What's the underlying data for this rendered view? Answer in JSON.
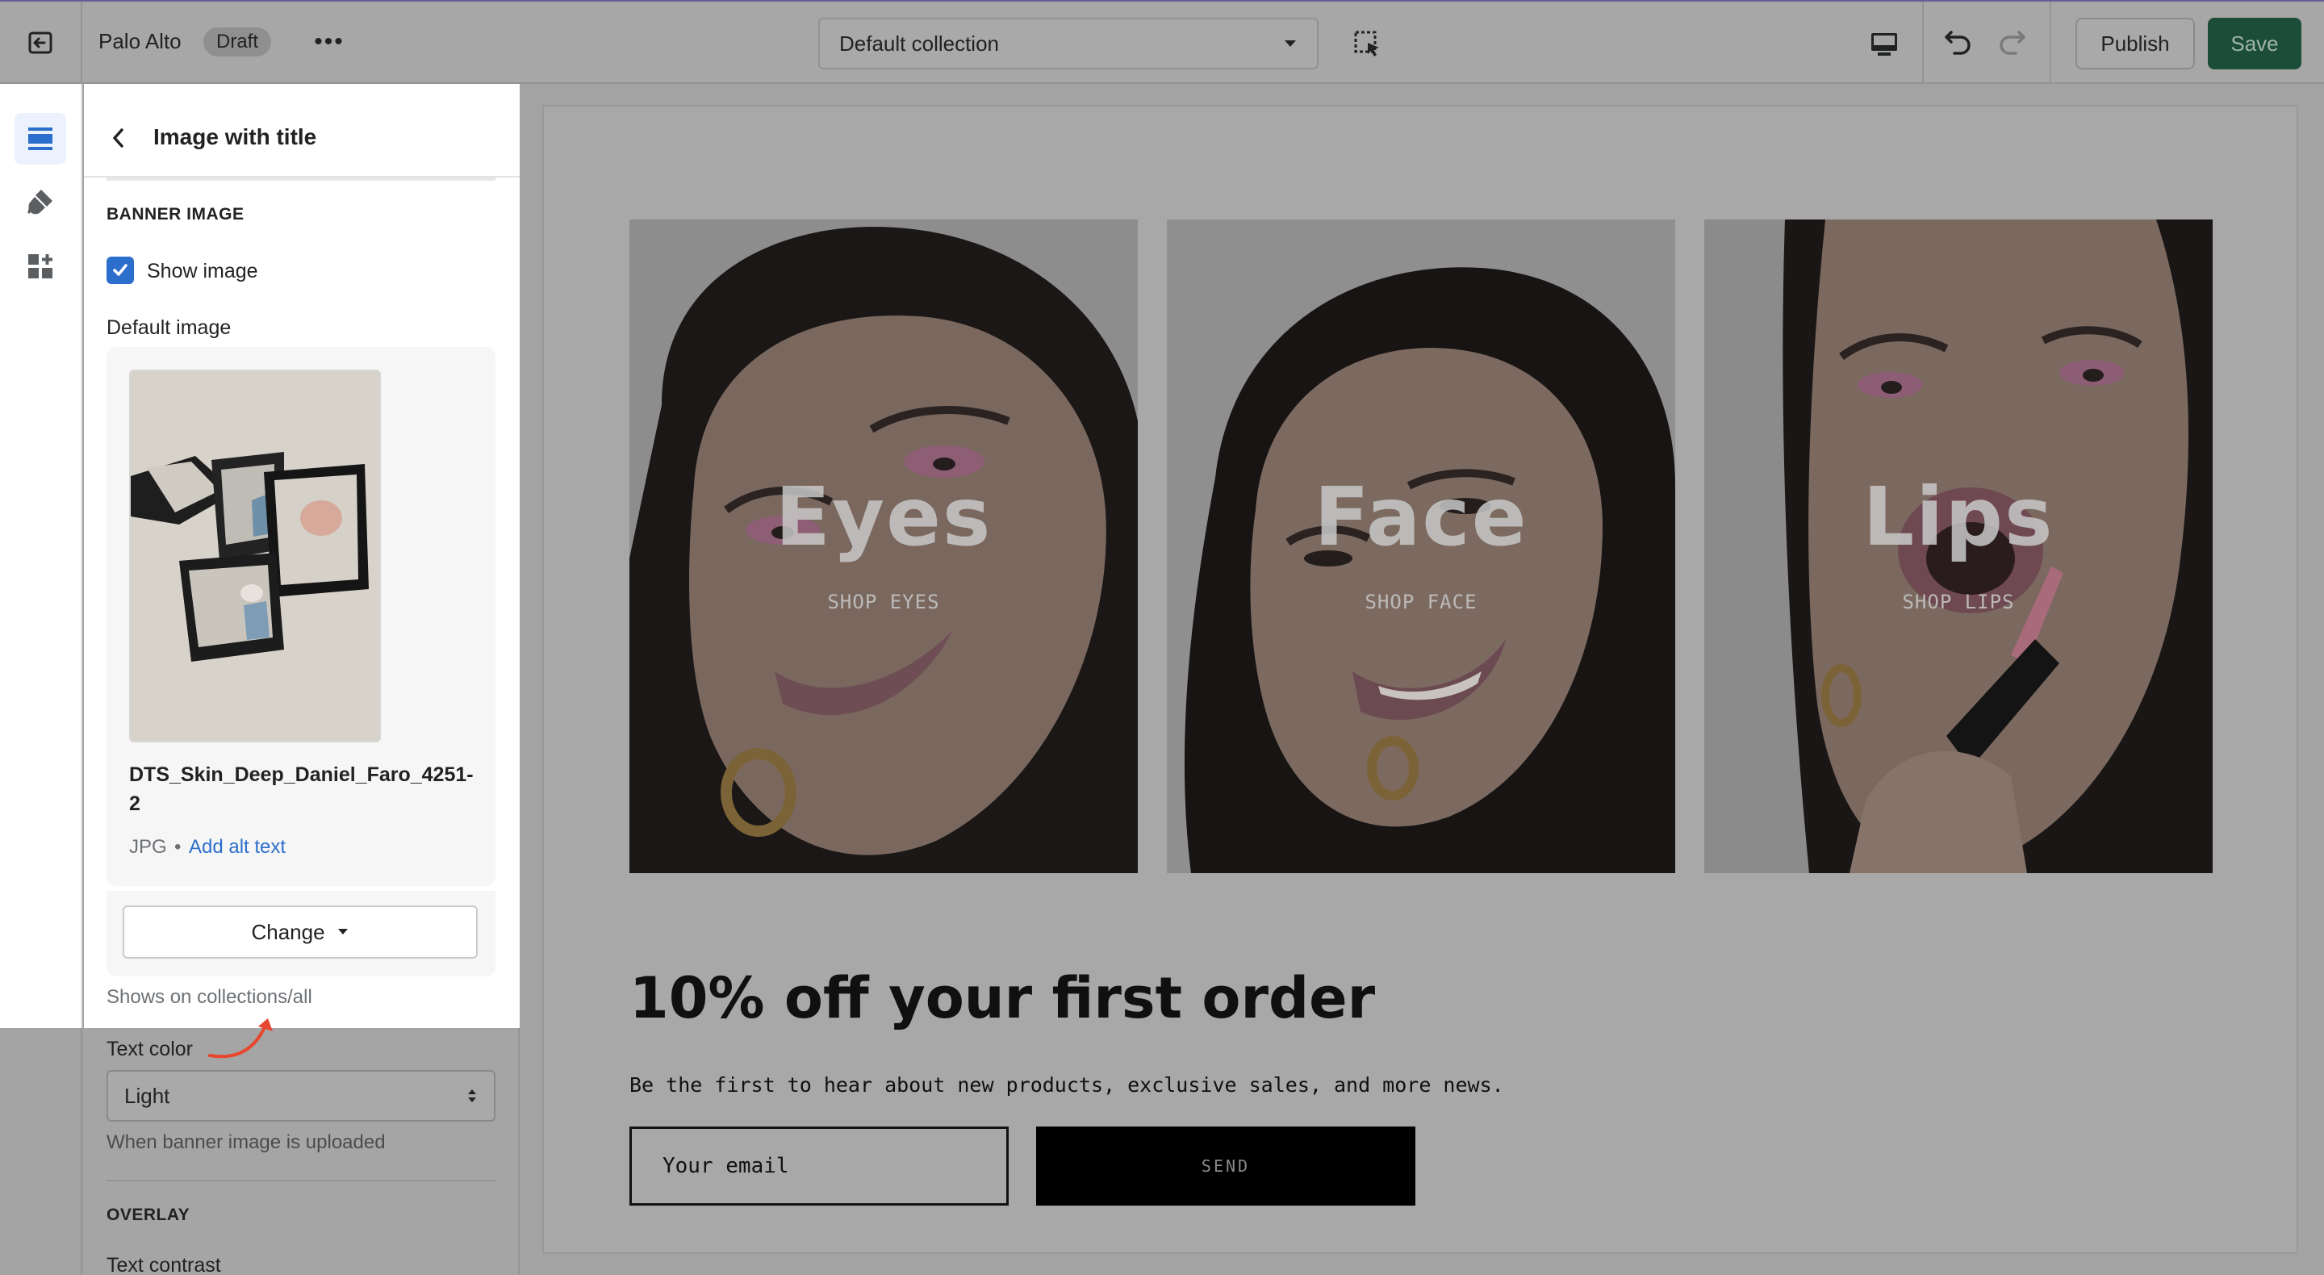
{
  "topbar": {
    "store_name": "Palo Alto",
    "badge": "Draft",
    "more_label": "•••",
    "collection": "Default collection",
    "publish_label": "Publish",
    "save_label": "Save"
  },
  "rail": {
    "items": [
      {
        "name": "sections",
        "icon": "sections-icon",
        "active": true
      },
      {
        "name": "theme-settings",
        "icon": "paintbrush-icon",
        "active": false
      },
      {
        "name": "apps",
        "icon": "apps-icon",
        "active": false
      }
    ]
  },
  "panel": {
    "title": "Image with title",
    "banner_heading": "BANNER IMAGE",
    "show_image_label": "Show image",
    "show_image_checked": true,
    "default_image_label": "Default image",
    "file_name": "DTS_Skin_Deep_Daniel_Faro_4251-2",
    "file_type": "JPG",
    "file_separator": "•",
    "add_alt_text": "Add alt text",
    "change_label": "Change",
    "shows_on": "Shows on collections/all",
    "text_color_label": "Text color",
    "text_color_value": "Light",
    "text_color_hint": "When banner image is uploaded",
    "overlay_heading": "OVERLAY",
    "text_contrast_label": "Text contrast"
  },
  "preview": {
    "tiles": [
      {
        "title": "Eyes",
        "subtitle": "SHOP EYES"
      },
      {
        "title": "Face",
        "subtitle": "SHOP FACE"
      },
      {
        "title": "Lips",
        "subtitle": "SHOP LIPS"
      }
    ],
    "promo_heading": "10% off your first order",
    "promo_text": "Be the first to hear about new products, exclusive sales, and more news.",
    "email_placeholder": "Your email",
    "send_label": "SEND"
  },
  "colors": {
    "accent": "#2c6ecb",
    "save_button": "#1c4d38",
    "annotation_arrow": "#e8462e"
  }
}
